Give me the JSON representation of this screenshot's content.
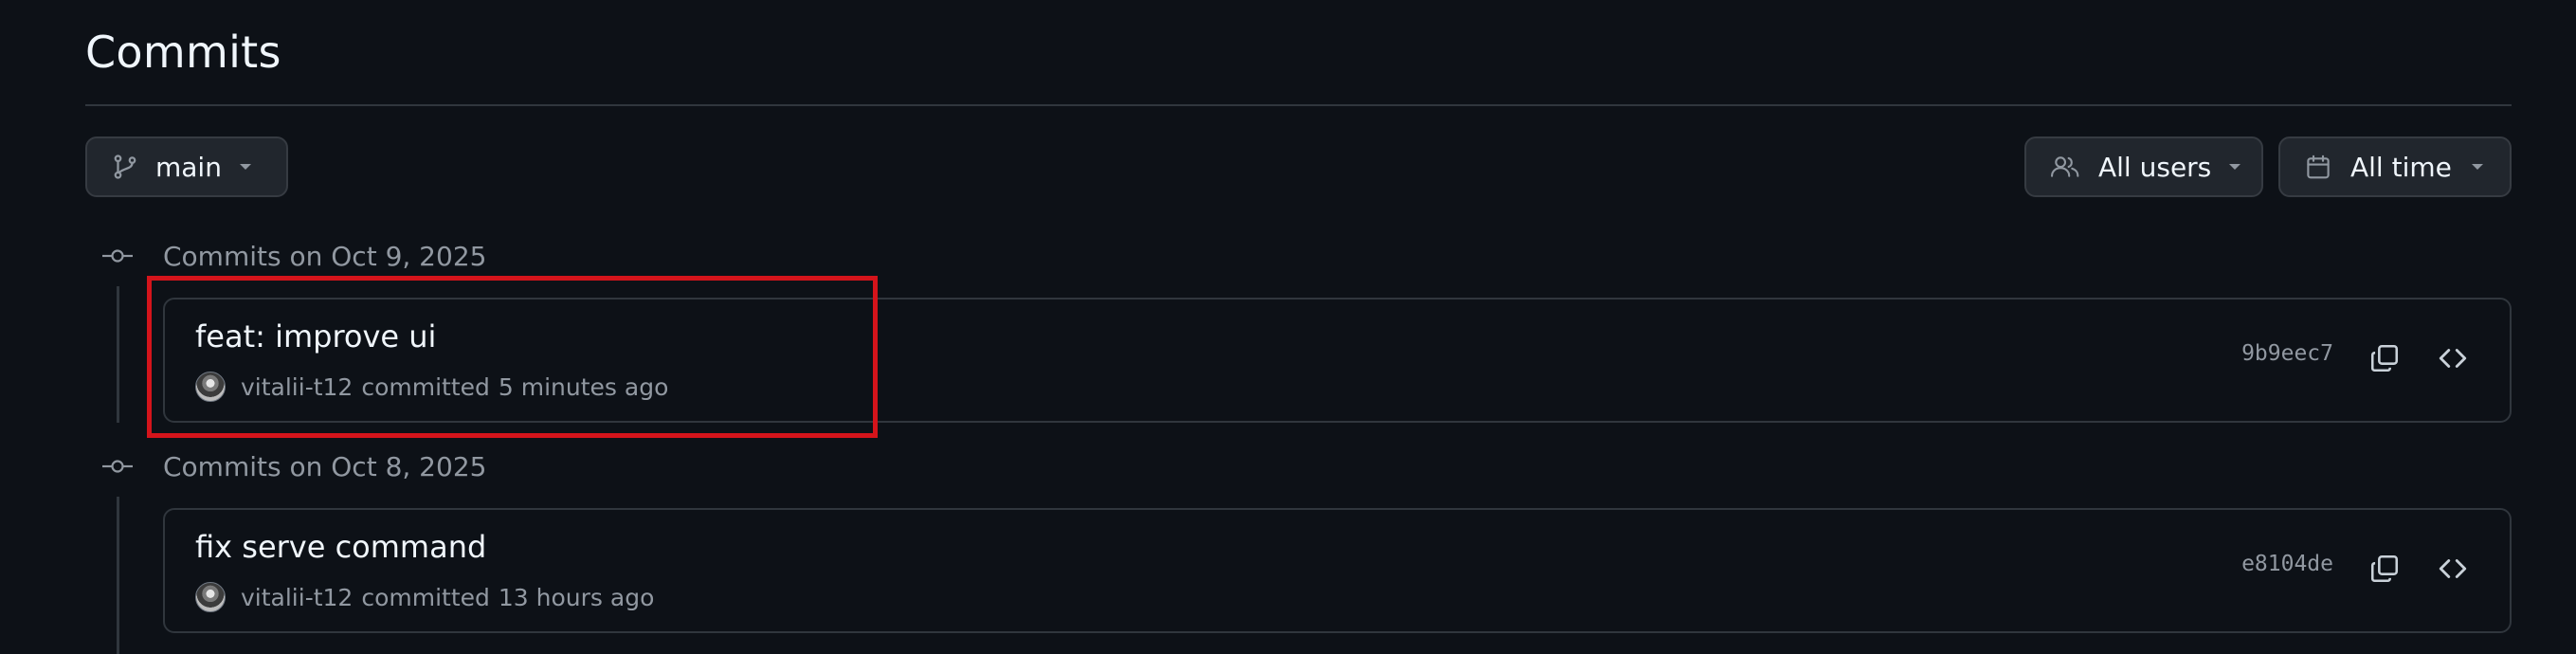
{
  "page": {
    "title": "Commits"
  },
  "toolbar": {
    "branch_label": "main",
    "users_label": "All users",
    "time_label": "All time"
  },
  "groups": [
    {
      "label": "Commits on Oct 9, 2025",
      "commits": [
        {
          "title": "feat: improve ui",
          "author": "vitalii-t12",
          "action": "committed",
          "time": "5 minutes ago",
          "sha": "9b9eec7"
        }
      ]
    },
    {
      "label": "Commits on Oct 8, 2025",
      "commits": [
        {
          "title": "fix serve command",
          "author": "vitalii-t12",
          "action": "committed",
          "time": "13 hours ago",
          "sha": "e8104de"
        }
      ]
    }
  ],
  "icons": {
    "branch": "git-branch-icon",
    "users": "people-icon",
    "time": "calendar-icon",
    "caret": "triangle-down-icon",
    "copy": "copy-icon",
    "code": "code-icon",
    "node": "git-commit-icon"
  },
  "colors": {
    "background": "#0d1117",
    "highlight": "#d4141b"
  }
}
